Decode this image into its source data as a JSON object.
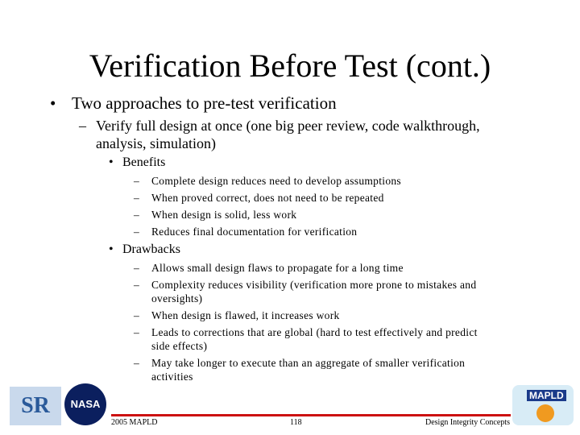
{
  "title": "Verification Before Test (cont.)",
  "bullet1": "Two approaches to pre-test verification",
  "sub1": "Verify full design at once (one big peer review, code walkthrough,",
  "sub1b": "analysis, simulation)",
  "benefits": {
    "label": "Benefits",
    "items": [
      "Complete design reduces need to develop assumptions",
      "When proved correct, does not need to be repeated",
      "When design is solid, less work",
      "Reduces final documentation for verification"
    ]
  },
  "drawbacks": {
    "label": "Drawbacks",
    "items": [
      [
        "Allows small design flaws to propagate for a long time"
      ],
      [
        "Complexity reduces visibility (verification more prone to mistakes and",
        "oversights)"
      ],
      [
        "When design is flawed, it increases work"
      ],
      [
        "Leads to corrections that are global (hard to test effectively and predict",
        "side effects)"
      ],
      [
        "May take longer to execute than an aggregate of smaller verification",
        "activities"
      ]
    ]
  },
  "footer": {
    "left": "2005 MAPLD",
    "center": "118",
    "right": "Design Integrity Concepts"
  },
  "logos": {
    "srr": "SR",
    "nasa": "NASA",
    "mapld": "MAPLD"
  },
  "colors": {
    "footer_rule": "#cc1111"
  }
}
